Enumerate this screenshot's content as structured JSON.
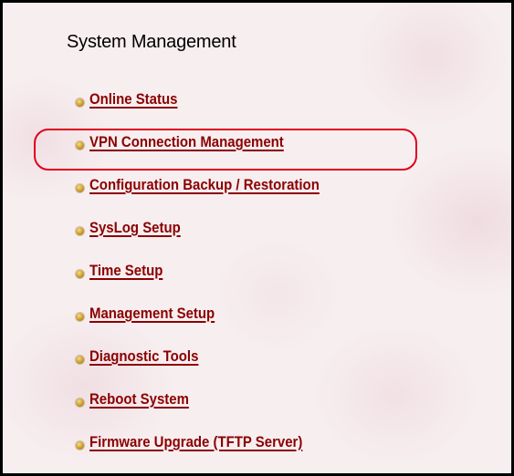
{
  "page": {
    "title": "System Management",
    "accent_color": "#8b0000",
    "highlight_color": "#e0001c"
  },
  "menu": {
    "items": [
      {
        "label": "Online Status",
        "icon": "bullet-icon"
      },
      {
        "label": "VPN Connection Management",
        "icon": "bullet-icon",
        "highlighted": true
      },
      {
        "label": "Configuration Backup / Restoration",
        "icon": "bullet-icon"
      },
      {
        "label": "SysLog Setup",
        "icon": "bullet-icon"
      },
      {
        "label": "Time Setup",
        "icon": "bullet-icon"
      },
      {
        "label": "Management Setup",
        "icon": "bullet-icon"
      },
      {
        "label": "Diagnostic Tools",
        "icon": "bullet-icon"
      },
      {
        "label": "Reboot System",
        "icon": "bullet-icon"
      },
      {
        "label": "Firmware Upgrade (TFTP Server)",
        "icon": "bullet-icon"
      }
    ]
  }
}
